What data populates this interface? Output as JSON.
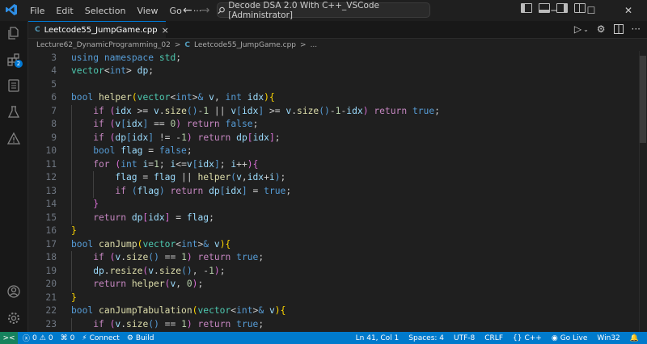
{
  "menu": [
    "File",
    "Edit",
    "Selection",
    "View",
    "Go"
  ],
  "search": {
    "text": "Decode DSA 2.0 With C++_VSCode [Administrator]"
  },
  "window_controls": {
    "minimize": "─",
    "maximize": "☐",
    "close": "✕"
  },
  "activity": {
    "source_control_badge": "2"
  },
  "tab": {
    "icon": "C",
    "label": "Leetcode55_JumpGame.cpp",
    "close": "×"
  },
  "breadcrumb": {
    "folder": "Lecture62_DynamicProgramming_02",
    "sep": ">",
    "icon": "C",
    "file": "Leetcode55_JumpGame.cpp",
    "sep2": ">",
    "more": "..."
  },
  "code": [
    {
      "n": "3",
      "indent": 0,
      "html": "<span class='k'>using</span> <span class='k'>namespace</span> <span class='t'>std</span>;"
    },
    {
      "n": "4",
      "indent": 0,
      "html": "<span class='t'>vector</span><span class='o'>&lt;</span><span class='k'>int</span><span class='o'>&gt;</span> <span class='v'>dp</span>;"
    },
    {
      "n": "5",
      "indent": 0,
      "html": ""
    },
    {
      "n": "6",
      "indent": 0,
      "html": "<span class='k'>bool</span> <span class='f'>helper</span><span class='y'>(</span><span class='t'>vector</span>&lt;<span class='k'>int</span>&gt;<span class='k'>&amp;</span> <span class='v'>v</span>, <span class='k'>int</span> <span class='v'>idx</span><span class='y'>)</span><span class='y'>{</span>"
    },
    {
      "n": "7",
      "indent": 1,
      "html": "<span class='c'>if</span> <span class='p'>(</span><span class='v'>idx</span> &gt;= <span class='v'>v</span>.<span class='f'>size</span><span class='k'>()</span>-<span class='n'>1</span> || <span class='v'>v</span><span class='k'>[</span><span class='v'>idx</span><span class='k'>]</span> &gt;= <span class='v'>v</span>.<span class='f'>size</span><span class='k'>()</span>-<span class='n'>1</span>-<span class='v'>idx</span><span class='p'>)</span> <span class='c'>return</span> <span class='k'>true</span>;"
    },
    {
      "n": "8",
      "indent": 1,
      "html": "<span class='c'>if</span> <span class='p'>(</span><span class='v'>v</span><span class='k'>[</span><span class='v'>idx</span><span class='k'>]</span> == <span class='n'>0</span><span class='p'>)</span> <span class='c'>return</span> <span class='k'>false</span>;"
    },
    {
      "n": "9",
      "indent": 1,
      "html": "<span class='c'>if</span> <span class='p'>(</span><span class='v'>dp</span><span class='k'>[</span><span class='v'>idx</span><span class='k'>]</span> != -<span class='n'>1</span><span class='p'>)</span> <span class='c'>return</span> <span class='v'>dp</span><span class='p'>[</span><span class='v'>idx</span><span class='p'>]</span>;"
    },
    {
      "n": "10",
      "indent": 1,
      "html": "<span class='k'>bool</span> <span class='v'>flag</span> = <span class='k'>false</span>;"
    },
    {
      "n": "11",
      "indent": 1,
      "html": "<span class='c'>for</span> <span class='p'>(</span><span class='k'>int</span> <span class='v'>i</span>=<span class='n'>1</span>; <span class='v'>i</span>&lt;=<span class='v'>v</span><span class='k'>[</span><span class='v'>idx</span><span class='k'>]</span>; <span class='v'>i</span>++<span class='p'>)</span><span class='p'>{</span>"
    },
    {
      "n": "12",
      "indent": 2,
      "html": "<span class='v'>flag</span> = <span class='v'>flag</span> || <span class='f'>helper</span><span class='k'>(</span><span class='v'>v</span>,<span class='v'>idx</span>+<span class='v'>i</span><span class='k'>)</span>;"
    },
    {
      "n": "13",
      "indent": 2,
      "html": "<span class='c'>if</span> <span class='k'>(</span><span class='v'>flag</span><span class='k'>)</span> <span class='c'>return</span> <span class='v'>dp</span><span class='k'>[</span><span class='v'>idx</span><span class='k'>]</span> = <span class='k'>true</span>;"
    },
    {
      "n": "14",
      "indent": 1,
      "html": "<span class='p'>}</span>"
    },
    {
      "n": "15",
      "indent": 1,
      "html": "<span class='c'>return</span> <span class='v'>dp</span><span class='p'>[</span><span class='v'>idx</span><span class='p'>]</span> = <span class='v'>flag</span>;"
    },
    {
      "n": "16",
      "indent": 0,
      "html": "<span class='y'>}</span>"
    },
    {
      "n": "17",
      "indent": 0,
      "html": "<span class='k'>bool</span> <span class='f'>canJump</span><span class='y'>(</span><span class='t'>vector</span>&lt;<span class='k'>int</span>&gt;<span class='k'>&amp;</span> <span class='v'>v</span><span class='y'>)</span><span class='y'>{</span>"
    },
    {
      "n": "18",
      "indent": 1,
      "html": "<span class='c'>if</span> <span class='p'>(</span><span class='v'>v</span>.<span class='f'>size</span><span class='k'>()</span> == <span class='n'>1</span><span class='p'>)</span> <span class='c'>return</span> <span class='k'>true</span>;"
    },
    {
      "n": "19",
      "indent": 1,
      "html": "<span class='v'>dp</span>.<span class='f'>resize</span><span class='p'>(</span><span class='v'>v</span>.<span class='f'>size</span><span class='k'>()</span>, -<span class='n'>1</span><span class='p'>)</span>;"
    },
    {
      "n": "20",
      "indent": 1,
      "html": "<span class='c'>return</span> <span class='f'>helper</span><span class='p'>(</span><span class='v'>v</span>, <span class='n'>0</span><span class='p'>)</span>;"
    },
    {
      "n": "21",
      "indent": 0,
      "html": "<span class='y'>}</span>"
    },
    {
      "n": "22",
      "indent": 0,
      "html": "<span class='k'>bool</span> <span class='f'>canJumpTabulation</span><span class='y'>(</span><span class='t'>vector</span>&lt;<span class='k'>int</span>&gt;<span class='k'>&amp;</span> <span class='v'>v</span><span class='y'>)</span><span class='y'>{</span>"
    },
    {
      "n": "23",
      "indent": 1,
      "html": "<span class='c'>if</span> <span class='p'>(</span><span class='v'>v</span>.<span class='f'>size</span><span class='k'>()</span> == <span class='n'>1</span><span class='p'>)</span> <span class='c'>return</span> <span class='k'>true</span>;"
    }
  ],
  "status": {
    "errors": "0",
    "warnings": "0",
    "ports": "0",
    "connect": "Connect",
    "build": "Build",
    "position": "Ln 41, Col 1",
    "spaces": "Spaces: 4",
    "encoding": "UTF-8",
    "eol": "CRLF",
    "language": "C++",
    "golive": "Go Live",
    "platform": "Win32"
  },
  "colors": {
    "accent": "#007acc",
    "remote": "#16825d",
    "editor_bg": "#1f1f1f"
  }
}
